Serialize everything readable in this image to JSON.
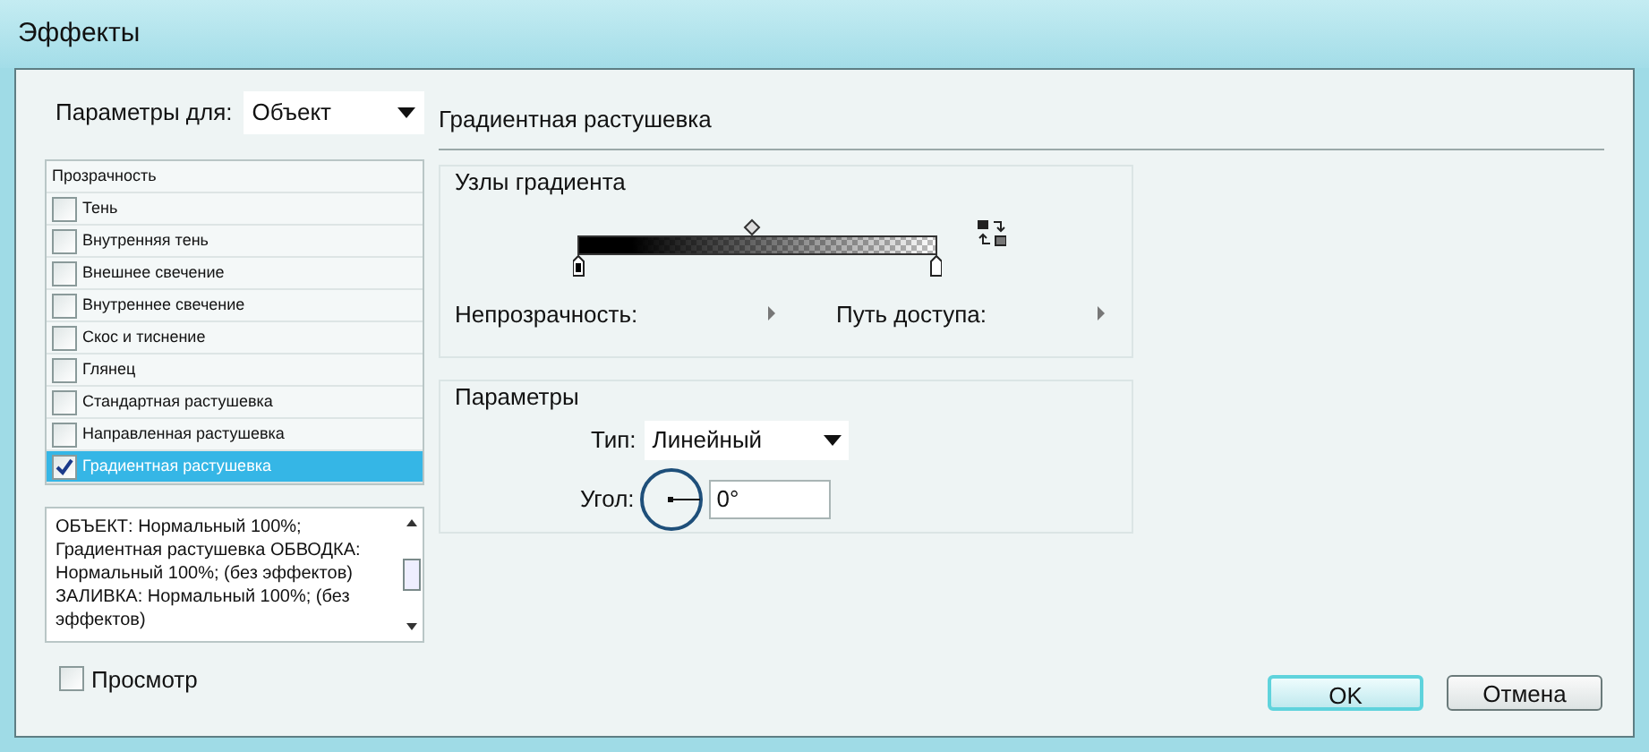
{
  "window": {
    "title": "Эффекты"
  },
  "settings_for": {
    "label": "Параметры для:",
    "value": "Объект"
  },
  "effects": [
    {
      "kind": "header",
      "label": "Прозрачность",
      "selected": false
    },
    {
      "kind": "checkbox",
      "label": "Тень",
      "checked": false,
      "selected": false
    },
    {
      "kind": "checkbox",
      "label": "Внутренняя тень",
      "checked": false,
      "selected": false
    },
    {
      "kind": "checkbox",
      "label": "Внешнее свечение",
      "checked": false,
      "selected": false
    },
    {
      "kind": "checkbox",
      "label": "Внутреннее свечение",
      "checked": false,
      "selected": false
    },
    {
      "kind": "checkbox",
      "label": "Скос и тиснение",
      "checked": false,
      "selected": false
    },
    {
      "kind": "checkbox",
      "label": "Глянец",
      "checked": false,
      "selected": false
    },
    {
      "kind": "checkbox",
      "label": "Стандартная растушевка",
      "checked": false,
      "selected": false
    },
    {
      "kind": "checkbox",
      "label": "Направленная растушевка",
      "checked": false,
      "selected": false
    },
    {
      "kind": "checkbox",
      "label": "Градиентная растушевка",
      "checked": true,
      "selected": true
    }
  ],
  "summary": "ОБЪЕКТ: Нормальный 100%; Градиентная растушевка ОБВОДКА: Нормальный 100%; (без эффектов) ЗАЛИВКА: Нормальный 100%; (без эффектов)",
  "preview": {
    "label": "Просмотр",
    "checked": false
  },
  "panel": {
    "title": "Градиентная растушевка",
    "stops_group": {
      "title": "Узлы градиента",
      "opacity_label": "Непрозрачность:",
      "location_label": "Путь доступа:"
    },
    "options_group": {
      "title": "Параметры",
      "type_label": "Тип:",
      "type_value": "Линейный",
      "angle_label": "Угол:",
      "angle_value": "0°"
    }
  },
  "buttons": [
    {
      "label": "OK",
      "default": true
    },
    {
      "label": "Отмена",
      "default": false
    }
  ]
}
